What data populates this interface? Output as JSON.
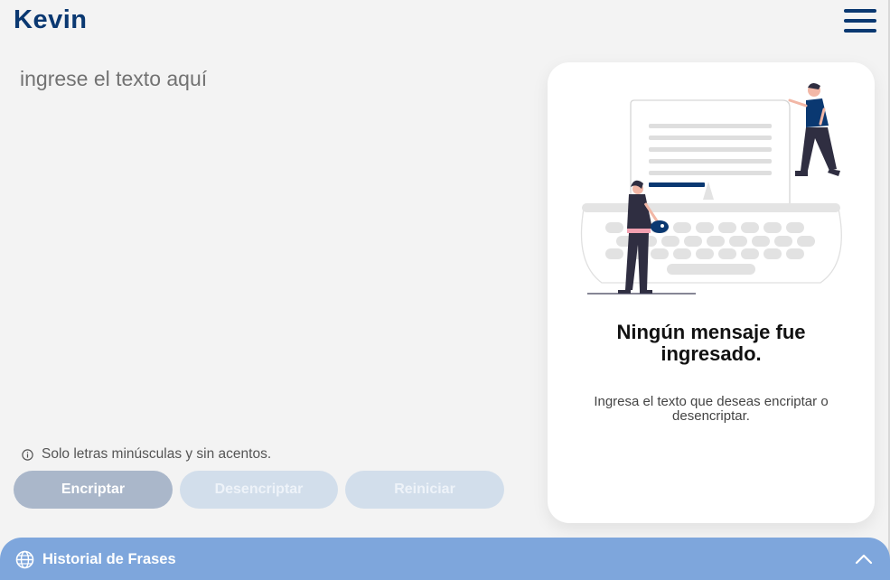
{
  "header": {
    "logo": "Kevin",
    "menu_icon": "hamburger-menu-icon"
  },
  "input": {
    "placeholder": "ingrese el texto aquí",
    "value": ""
  },
  "hint": {
    "icon": "info-icon",
    "text": "Solo letras minúsculas y sin acentos."
  },
  "buttons": {
    "encrypt_label": "Encriptar",
    "decrypt_label": "Desencriptar",
    "reset_label": "Reiniciar"
  },
  "output": {
    "illustration": "typewriter-illustration",
    "title": "Ningún mensaje fue ingresado.",
    "description": "Ingresa el texto que deseas encriptar o desencriptar."
  },
  "history": {
    "icon": "globe-icon",
    "label": "Historial de Frases",
    "toggle_icon": "chevron-up-icon"
  },
  "colors": {
    "brand": "#0a3871",
    "primary_button": "#aab7ca",
    "disabled_button": "#d2deeb",
    "history_bar": "#7ea6dc",
    "background": "#f3f3f3"
  }
}
